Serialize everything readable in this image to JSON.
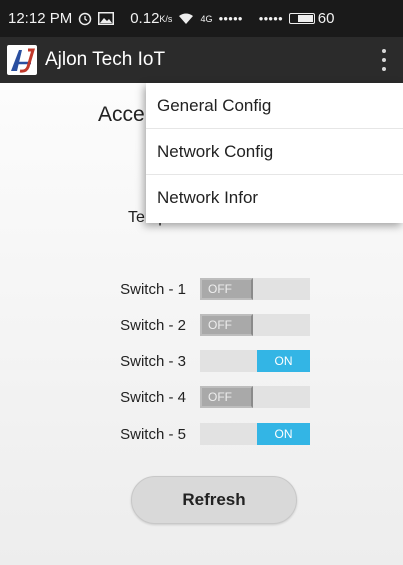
{
  "status_bar": {
    "time": "12:12 PM",
    "icons": [
      "alarm-icon",
      "image-icon"
    ],
    "data_rate": "0.12",
    "data_rate_unit": "K/s",
    "network_label": "4G",
    "signal_dots": "●●●●●",
    "signal_dots_2": "●●●●●",
    "battery_level": "60"
  },
  "app_bar": {
    "logo_text": "AJ",
    "title": "Ajlon Tech IoT",
    "overflow_icon": "more-vert-icon"
  },
  "main": {
    "heading_visible": "Acce",
    "temp_visible": "Temp : "
  },
  "switches": [
    {
      "label": "Switch - 1",
      "state": "OFF"
    },
    {
      "label": "Switch - 2",
      "state": "OFF"
    },
    {
      "label": "Switch - 3",
      "state": "ON"
    },
    {
      "label": "Switch - 4",
      "state": "OFF"
    },
    {
      "label": "Switch - 5",
      "state": "ON"
    }
  ],
  "refresh_label": "Refresh",
  "menu": {
    "items": [
      {
        "label": "General Config"
      },
      {
        "label": "Network Config"
      },
      {
        "label": "Network Infor"
      }
    ]
  },
  "colors": {
    "on_accent": "#33b5e5",
    "app_bar": "#2b2b2b",
    "status_bar": "#1a1a1a"
  }
}
